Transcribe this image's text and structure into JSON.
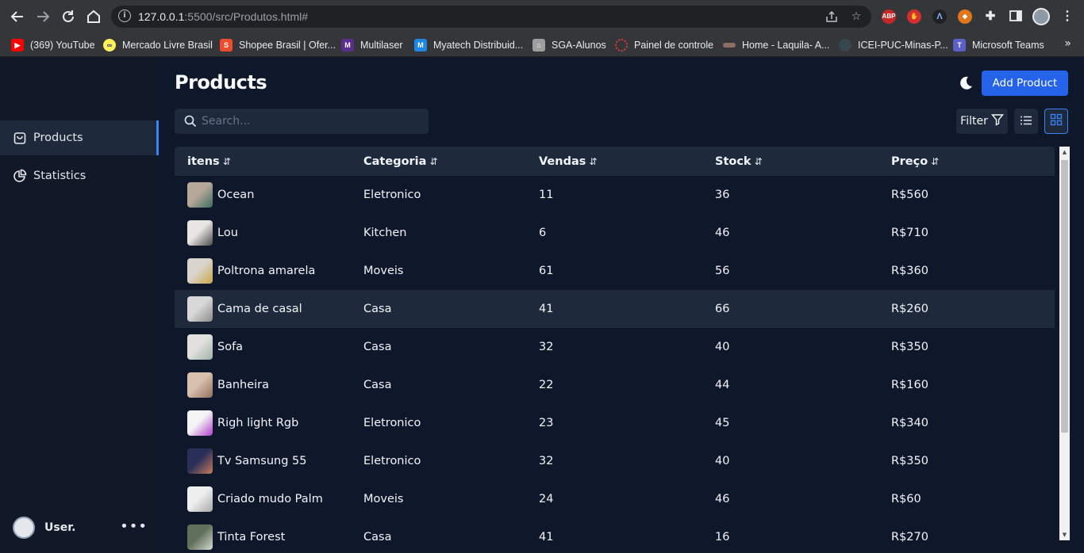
{
  "browser": {
    "url_host": "127.0.0.1",
    "url_rest": ":5500/src/Produtos.html#",
    "bookmarks": [
      {
        "label": "(369) YouTube",
        "icon": "youtube-icon",
        "color": "#ff0000"
      },
      {
        "label": "Mercado Livre Brasil",
        "icon": "mercadolivre-icon",
        "color": "#fff159"
      },
      {
        "label": "Shopee Brasil | Ofer...",
        "icon": "shopee-icon",
        "color": "#ee4d2d"
      },
      {
        "label": "Multilaser",
        "icon": "multilaser-icon",
        "color": "#5b2d8e"
      },
      {
        "label": "Myatech Distribuid...",
        "icon": "myatech-icon",
        "color": "#1e88e5"
      },
      {
        "label": "SGA-Alunos",
        "icon": "sga-icon",
        "color": "#9e9e9e"
      },
      {
        "label": "Painel de controle",
        "icon": "painel-icon",
        "color": "#e53935"
      },
      {
        "label": "Home - Laquila- A...",
        "icon": "laquila-icon",
        "color": "#8d6e63"
      },
      {
        "label": "ICEI-PUC-Minas-P...",
        "icon": "icei-icon",
        "color": "#37474f"
      },
      {
        "label": "Microsoft Teams",
        "icon": "teams-icon",
        "color": "#5b5fc7"
      }
    ],
    "more_label": "»"
  },
  "sidebar": {
    "items": [
      {
        "label": "Products",
        "icon": "shopping-bag-icon"
      },
      {
        "label": "Statistics",
        "icon": "pie-chart-icon"
      }
    ],
    "user_name": "User."
  },
  "header": {
    "title": "Products",
    "add_button": "Add Product",
    "search_placeholder": "Search...",
    "filter_label": "Filter"
  },
  "table": {
    "columns": [
      "itens",
      "Categoria",
      "Vendas",
      "Stock",
      "Preço"
    ],
    "sort_glyph": "⇵",
    "rows": [
      {
        "name": "Ocean",
        "category": "Eletronico",
        "sales": "11",
        "stock": "36",
        "price": "R$560",
        "thumb": [
          "#b7a99a",
          "#3d6b5e"
        ]
      },
      {
        "name": "Lou",
        "category": "Kitchen",
        "sales": "6",
        "stock": "46",
        "price": "R$710",
        "thumb": [
          "#e8e6e3",
          "#4a4a4a"
        ]
      },
      {
        "name": "Poltrona amarela",
        "category": "Moveis",
        "sales": "61",
        "stock": "56",
        "price": "R$360",
        "thumb": [
          "#d9d4cc",
          "#c9a646"
        ]
      },
      {
        "name": "Cama de casal",
        "category": "Casa",
        "sales": "41",
        "stock": "66",
        "price": "R$260",
        "thumb": [
          "#d8d8d8",
          "#8a8a8a"
        ]
      },
      {
        "name": "Sofa",
        "category": "Casa",
        "sales": "32",
        "stock": "40",
        "price": "R$350",
        "thumb": [
          "#e2e0dc",
          "#9db3a8"
        ]
      },
      {
        "name": "Banheira",
        "category": "Casa",
        "sales": "22",
        "stock": "44",
        "price": "R$160",
        "thumb": [
          "#d9bfae",
          "#8d6e5e"
        ]
      },
      {
        "name": "Righ light Rgb",
        "category": "Eletronico",
        "sales": "23",
        "stock": "45",
        "price": "R$340",
        "thumb": [
          "#f5f5f5",
          "#b03cc8"
        ]
      },
      {
        "name": "Tv Samsung 55",
        "category": "Eletronico",
        "sales": "32",
        "stock": "40",
        "price": "R$350",
        "thumb": [
          "#2a2f5a",
          "#c97a5b"
        ]
      },
      {
        "name": "Criado mudo Palm",
        "category": "Moveis",
        "sales": "24",
        "stock": "46",
        "price": "R$60",
        "thumb": [
          "#eeeeee",
          "#a8a8a8"
        ]
      },
      {
        "name": "Tinta Forest",
        "category": "Casa",
        "sales": "41",
        "stock": "16",
        "price": "R$270",
        "thumb": [
          "#5f6f5a",
          "#d9d9d2"
        ]
      }
    ],
    "highlighted_row": 3
  },
  "colors": {
    "background": "#0f172a",
    "sidebar": "#111827",
    "surface": "#1e293b",
    "accent": "#2563eb"
  }
}
